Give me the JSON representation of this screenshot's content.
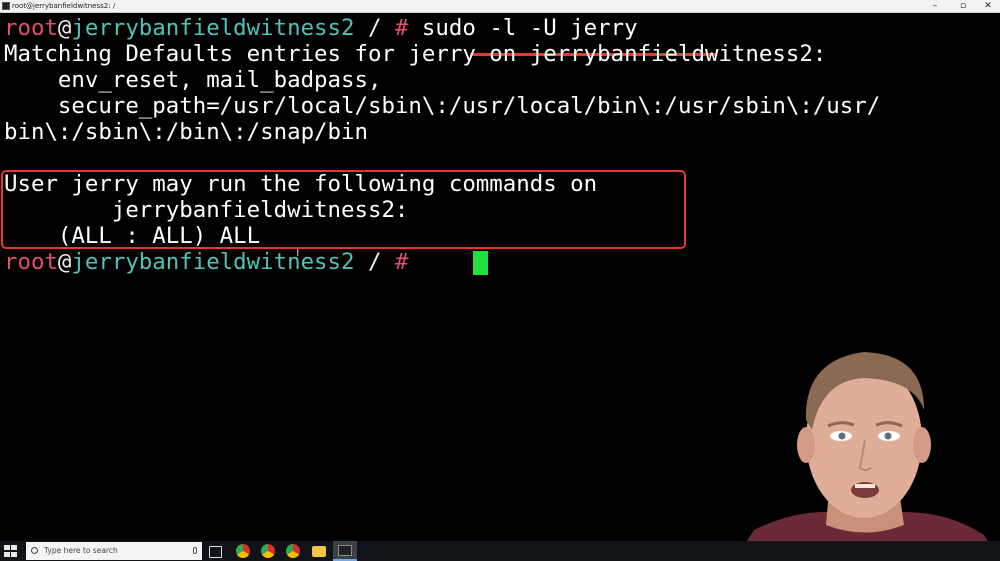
{
  "window": {
    "title": "root@jerrybanfieldwitness2: /",
    "minimize_glyph": "–",
    "maximize_glyph": "▫",
    "close_glyph": "✕"
  },
  "prompt": {
    "user": "root",
    "at": "@",
    "host": "jerrybanfieldwitness2",
    "path": " / ",
    "hash": "#"
  },
  "terminal": {
    "command": " sudo -l -U jerry",
    "output_lines": [
      "Matching Defaults entries for jerry on jerrybanfieldwitness2:",
      "    env_reset, mail_badpass,",
      "    secure_path=/usr/local/sbin\\:/usr/local/bin\\:/usr/sbin\\:/usr/",
      "bin\\:/sbin\\:/bin\\:/snap/bin",
      "",
      "User jerry may run the following commands on",
      "        jerrybanfieldwitness2:",
      "    (ALL : ALL) ALL"
    ],
    "mouse_cursor_glyph": "I"
  },
  "colors": {
    "prompt_user": "#e0506a",
    "prompt_host": "#4fc3b8",
    "annotation_red": "#e23b2e",
    "cursor_green": "#20e040",
    "background": "#000000"
  },
  "taskbar": {
    "search_placeholder": "Type here to search",
    "icons": [
      "windows-start-icon",
      "task-view-icon",
      "chrome-icon",
      "chrome-icon",
      "chrome-icon",
      "file-explorer-icon",
      "terminal-app-icon"
    ]
  }
}
